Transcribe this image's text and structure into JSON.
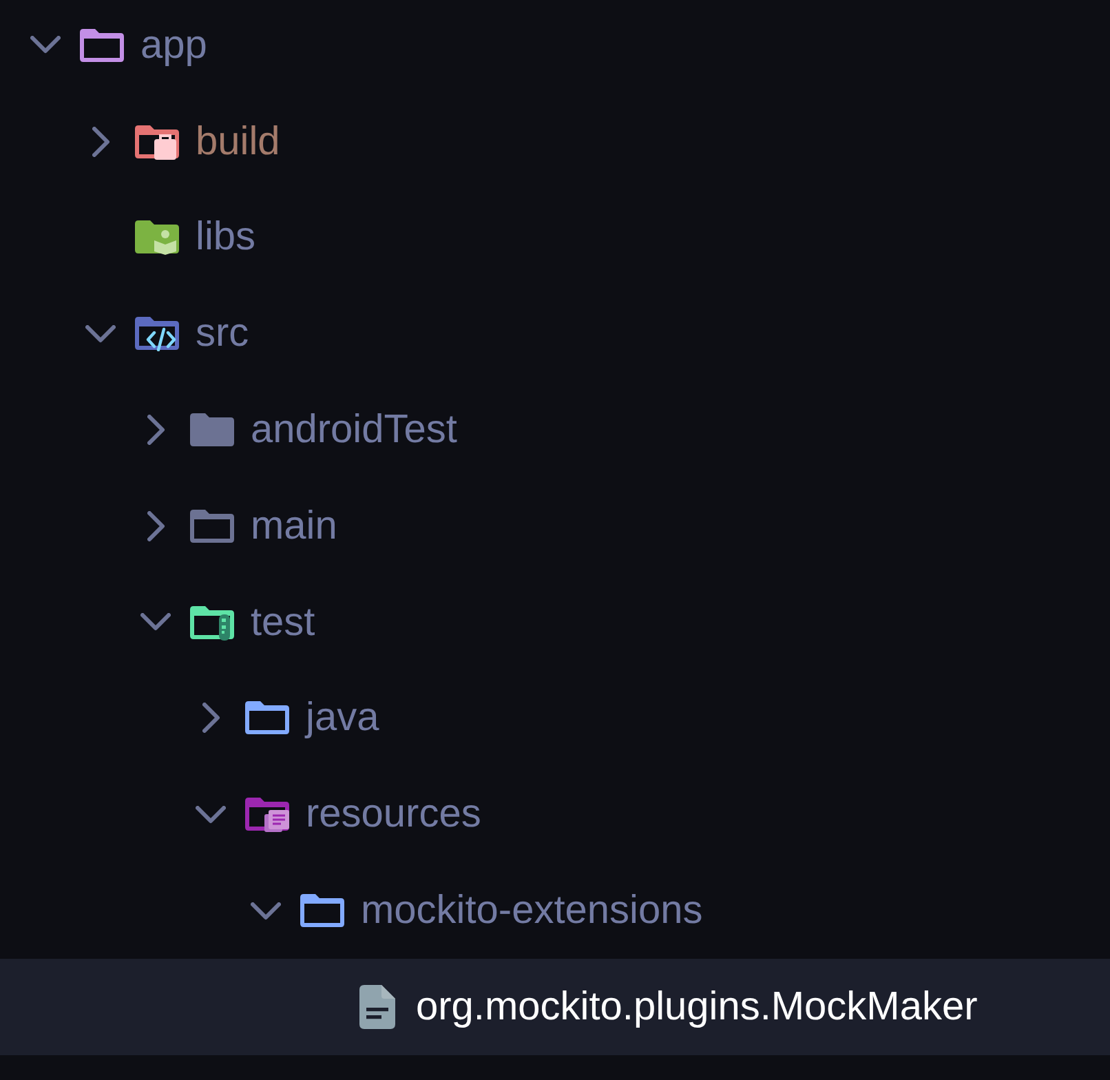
{
  "tree": [
    {
      "label": "app",
      "kind": "folder",
      "color": "#c38fe6",
      "expanded": true,
      "selected": false,
      "excluded": false,
      "children": [
        {
          "label": "build",
          "kind": "build",
          "color": "#e57373",
          "expanded": false,
          "selected": false,
          "excluded": true
        },
        {
          "label": "libs",
          "kind": "library",
          "color": "#7cb342",
          "selected": false,
          "excluded": false
        },
        {
          "label": "src",
          "kind": "source",
          "color": "#5c6bc0",
          "expanded": true,
          "selected": false,
          "excluded": false,
          "children": [
            {
              "label": "androidTest",
              "kind": "filled",
              "color": "#6c7293",
              "expanded": false,
              "selected": false,
              "excluded": false
            },
            {
              "label": "main",
              "kind": "folder",
              "color": "#6c7293",
              "expanded": false,
              "selected": false,
              "excluded": false
            },
            {
              "label": "test",
              "kind": "test",
              "color": "#5ee3a6",
              "expanded": true,
              "selected": false,
              "excluded": false,
              "children": [
                {
                  "label": "java",
                  "kind": "folder",
                  "color": "#82aaff",
                  "expanded": false,
                  "selected": false,
                  "excluded": false
                },
                {
                  "label": "resources",
                  "kind": "resources",
                  "color": "#9c27b0",
                  "expanded": true,
                  "selected": false,
                  "excluded": false,
                  "children": [
                    {
                      "label": "mockito-extensions",
                      "kind": "folder",
                      "color": "#82aaff",
                      "expanded": true,
                      "selected": false,
                      "excluded": false,
                      "children": [
                        {
                          "label": "org.mockito.plugins.MockMaker",
                          "kind": "file",
                          "color": "#90a4ae",
                          "selected": true,
                          "excluded": false
                        }
                      ]
                    }
                  ]
                }
              ]
            }
          ]
        }
      ]
    }
  ]
}
